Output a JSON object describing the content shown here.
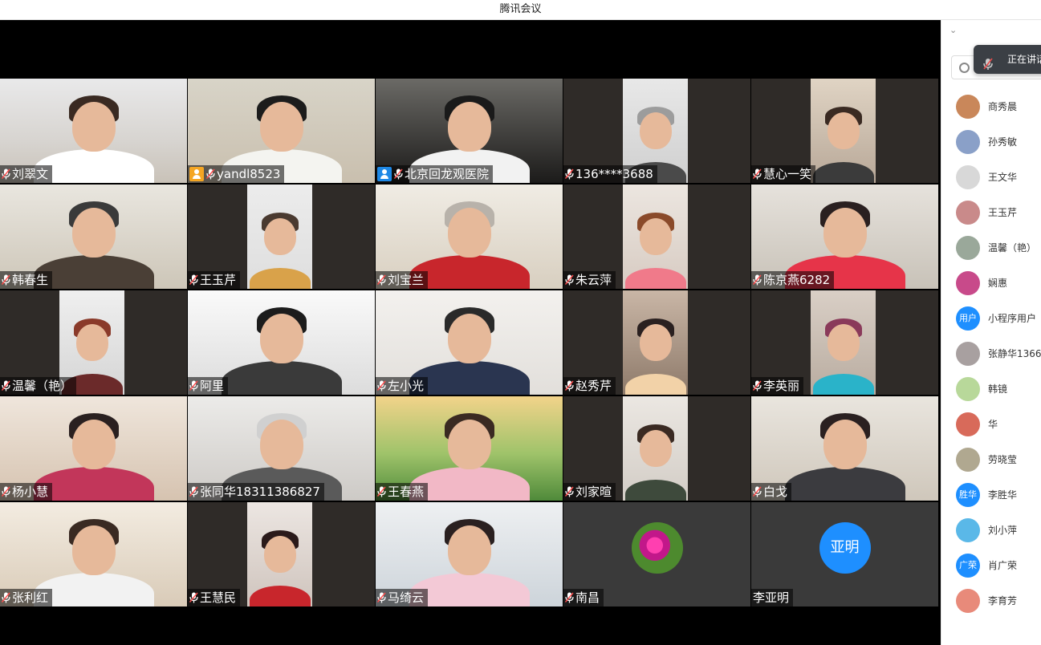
{
  "app": {
    "title": "腾讯会议"
  },
  "colors": {
    "accent": "#1e8fff",
    "speaking_border": "#2fb86a",
    "host_badge": "#f5a623",
    "stage_bg": "#000000"
  },
  "tiles": [
    {
      "name": "刘翠文",
      "mic": true
    },
    {
      "name": "yandl8523",
      "mic": true,
      "badge": "host"
    },
    {
      "name": "北京回龙观医院",
      "mic": true,
      "badge": "cohost",
      "speaking": true
    },
    {
      "name": "136****3688",
      "mic": true
    },
    {
      "name": "慧心一笑",
      "mic": true
    },
    {
      "name": "韩春生",
      "mic": true
    },
    {
      "name": "王玉芹",
      "mic": true
    },
    {
      "name": "刘宝兰",
      "mic": true
    },
    {
      "name": "朱云萍",
      "mic": true
    },
    {
      "name": "陈京燕6282",
      "mic": true
    },
    {
      "name": "温馨（艳）",
      "mic": true
    },
    {
      "name": "阿里",
      "mic": true
    },
    {
      "name": "左小光",
      "mic": true
    },
    {
      "name": "赵秀芹",
      "mic": true
    },
    {
      "name": "李英丽",
      "mic": true
    },
    {
      "name": "杨小慧",
      "mic": true
    },
    {
      "name": "张同华18311386827",
      "mic": true
    },
    {
      "name": "王春燕",
      "mic": true
    },
    {
      "name": "刘家暄",
      "mic": true
    },
    {
      "name": "白戈",
      "mic": true
    },
    {
      "name": "张利红",
      "mic": true
    },
    {
      "name": "王慧民",
      "mic": true
    },
    {
      "name": "马绮云",
      "mic": true
    },
    {
      "name": "南昌",
      "mic": true,
      "avatar": "flower-icon"
    },
    {
      "name": "李亚明",
      "mic": false,
      "avatar_text": "亚明"
    }
  ],
  "sidebar": {
    "speaking_label": "正在讲话",
    "participants": [
      {
        "name": "商秀晨"
      },
      {
        "name": "孙秀敏"
      },
      {
        "name": "王文华"
      },
      {
        "name": "王玉芹"
      },
      {
        "name": "温馨（艳）"
      },
      {
        "name": "娴惠"
      },
      {
        "name": "小程序用户",
        "avatar_text": "用户"
      },
      {
        "name": "张静华1366"
      },
      {
        "name": "韩镜"
      },
      {
        "name": "华"
      },
      {
        "name": "劳晓莹"
      },
      {
        "name": "李胜华",
        "avatar_text": "胜华"
      },
      {
        "name": "刘小萍"
      },
      {
        "name": "肖广荣",
        "avatar_text": "广荣"
      },
      {
        "name": "李育芳"
      }
    ]
  }
}
